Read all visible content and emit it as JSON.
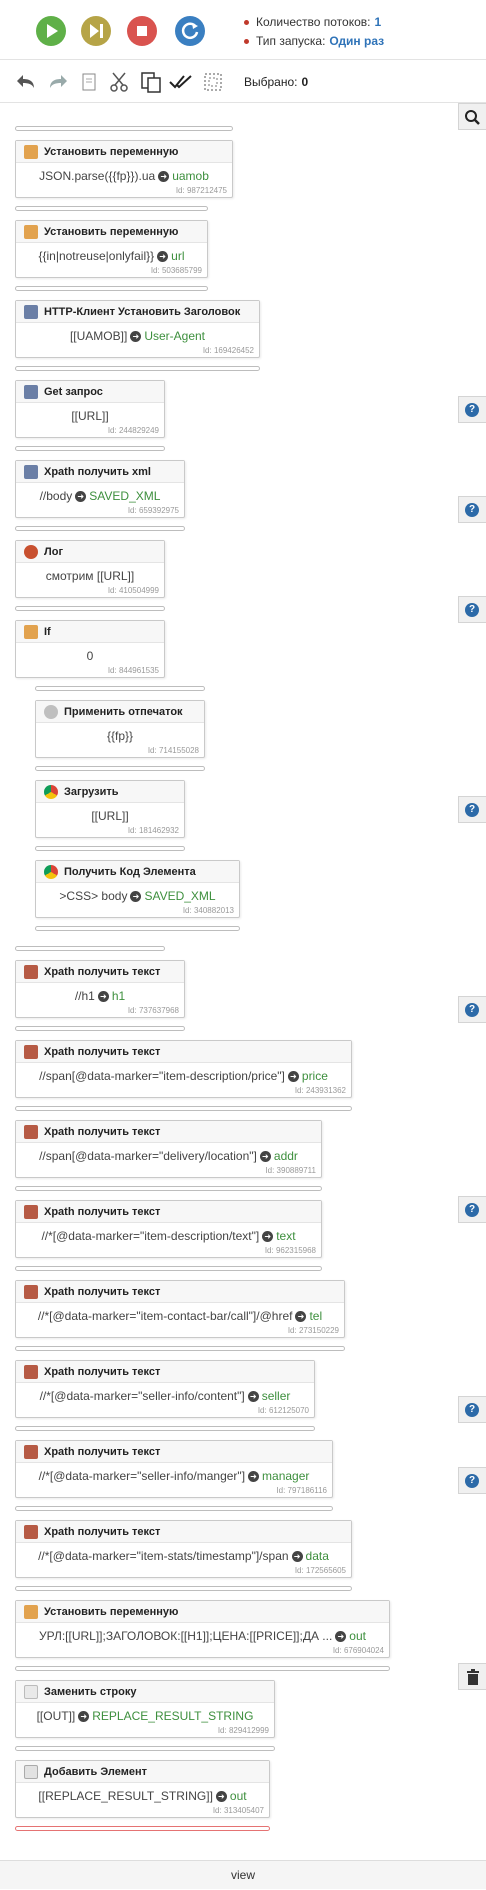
{
  "threads": {
    "label": "Количество потоков:",
    "value": "1"
  },
  "launch": {
    "label": "Тип запуска:",
    "value": "Один раз"
  },
  "selected": {
    "label": "Выбрано:",
    "value": "0"
  },
  "footer": {
    "label": "view"
  },
  "nodes": [
    {
      "icon": "variable-icon",
      "title": "Установить переменную",
      "expr": "JSON.parse({{fp}}).ua",
      "var": "uamob",
      "id": "Id: 987212475"
    },
    {
      "icon": "variable-icon",
      "title": "Установить переменную",
      "expr": "{{in|notreuse|onlyfail}}",
      "var": "url",
      "id": "Id: 503685799"
    },
    {
      "icon": "http-icon",
      "title": "HTTP-Клиент Установить Заголовок",
      "expr": "[[UAMOB]]",
      "var": "User-Agent",
      "id": "Id: 169426452"
    },
    {
      "icon": "http-icon",
      "title": "Get запрос",
      "expr": "[[URL]]",
      "var": "",
      "id": "Id: 244829249"
    },
    {
      "icon": "http-icon",
      "title": "Xpath получить xml",
      "expr": "//body",
      "var": "SAVED_XML",
      "id": "Id: 659392975"
    },
    {
      "icon": "log-icon",
      "title": "Лог",
      "expr": "смотрим [[URL]]",
      "var": "",
      "id": "Id: 410504999"
    },
    {
      "icon": "if-icon",
      "title": "If",
      "expr": "0",
      "var": "",
      "id": "Id: 844961535"
    },
    {
      "icon": "fingerprint-icon",
      "title": "Применить отпечаток",
      "expr": "{{fp}}",
      "var": "",
      "id": "Id: 714155028"
    },
    {
      "icon": "chrome-icon",
      "title": "Загрузить",
      "expr": "[[URL]]",
      "var": "",
      "id": "Id: 181462932"
    },
    {
      "icon": "chrome-icon",
      "title": "Получить Код Элемента",
      "expr": ">CSS> body",
      "var": "SAVED_XML",
      "id": "Id: 340882013"
    },
    {
      "icon": "xpath-icon",
      "title": "Xpath получить текст",
      "expr": "//h1",
      "var": "h1",
      "id": "Id: 737637968"
    },
    {
      "icon": "xpath-icon",
      "title": "Xpath получить текст",
      "expr": "//span[@data-marker=\"item-description/price\"]",
      "var": "price",
      "id": "Id: 243931362"
    },
    {
      "icon": "xpath-icon",
      "title": "Xpath получить текст",
      "expr": "//span[@data-marker=\"delivery/location\"]",
      "var": "addr",
      "id": "Id: 390889711"
    },
    {
      "icon": "xpath-icon",
      "title": "Xpath получить текст",
      "expr": "//*[@data-marker=\"item-description/text\"]",
      "var": "text",
      "id": "Id: 962315968"
    },
    {
      "icon": "xpath-icon",
      "title": "Xpath получить текст",
      "expr": "//*[@data-marker=\"item-contact-bar/call\"]/@href",
      "var": "tel",
      "id": "Id: 273150229"
    },
    {
      "icon": "xpath-icon",
      "title": "Xpath получить текст",
      "expr": "//*[@data-marker=\"seller-info/content\"]",
      "var": "seller",
      "id": "Id: 612125070"
    },
    {
      "icon": "xpath-icon",
      "title": "Xpath получить текст",
      "expr": "//*[@data-marker=\"seller-info/manger\"]",
      "var": "manager",
      "id": "Id: 797186116"
    },
    {
      "icon": "xpath-icon",
      "title": "Xpath получить текст",
      "expr": "//*[@data-marker=\"item-stats/timestamp\"]/span",
      "var": "data",
      "id": "Id: 172565605"
    },
    {
      "icon": "variable-icon",
      "title": "Установить переменную",
      "expr": "УРЛ:[[URL]];ЗАГОЛОВОК:[[H1]];ЦЕНА:[[PRICE]];ДА ...",
      "var": "out",
      "id": "Id: 676904024"
    },
    {
      "icon": "replace-icon",
      "title": "Заменить строку",
      "expr": "[[OUT]]",
      "var": "REPLACE_RESULT_STRING",
      "id": "Id: 829412999"
    },
    {
      "icon": "add-element-icon",
      "title": "Добавить Элемент",
      "expr": "[[REPLACE_RESULT_STRING]]",
      "var": "out",
      "id": "Id: 313405407"
    }
  ]
}
